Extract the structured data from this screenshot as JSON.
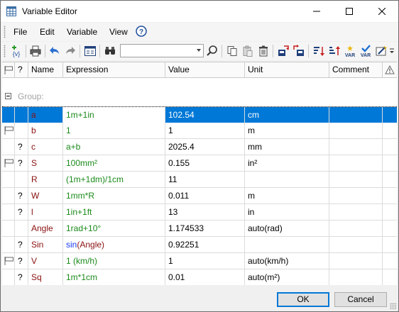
{
  "window": {
    "title": "Variable Editor"
  },
  "menu": [
    "File",
    "Edit",
    "Variable",
    "View"
  ],
  "toolbar": {
    "insert_label": "{v}",
    "search_value": ""
  },
  "columns": {
    "flag": "",
    "q": "?",
    "name": "Name",
    "expression": "Expression",
    "value": "Value",
    "unit": "Unit",
    "comment": "Comment"
  },
  "group": {
    "label": "Group:"
  },
  "rows": [
    {
      "flag": false,
      "q": "",
      "name": "a",
      "expression": "1m+1in",
      "value": "102.54",
      "unit": "cm"
    },
    {
      "flag": true,
      "q": "",
      "name": "b",
      "expression": "1",
      "value": "1",
      "unit": "m"
    },
    {
      "flag": false,
      "q": "?",
      "name": "c",
      "expression": "a+b",
      "value": "2025.4",
      "unit": "mm"
    },
    {
      "flag": true,
      "q": "?",
      "name": "S",
      "expression": "100mm²",
      "value": "0.155",
      "unit": "in²"
    },
    {
      "flag": false,
      "q": "",
      "name": "R",
      "expression": "(1m+1dm)/1cm",
      "value": "11",
      "unit": ""
    },
    {
      "flag": false,
      "q": "?",
      "name": "W",
      "expression": "1mm*R",
      "value": "0.011",
      "unit": "m"
    },
    {
      "flag": false,
      "q": "?",
      "name": "l",
      "expression": "1in+1ft",
      "value": "13",
      "unit": "in"
    },
    {
      "flag": false,
      "q": "",
      "name": "Angle",
      "expression": "1rad+10°",
      "value": "1.174533",
      "unit": "auto(rad)"
    },
    {
      "flag": false,
      "q": "?",
      "name": "Sin",
      "expression_fn": "sin",
      "expression_arg": "(Angle)",
      "value": "0.92251",
      "unit": ""
    },
    {
      "flag": true,
      "q": "?",
      "name": "V",
      "expression": "1 (km/h)",
      "value": "1",
      "unit": "auto(km/h)"
    },
    {
      "flag": false,
      "q": "?",
      "name": "Sq",
      "expression": "1m*1cm",
      "value": "0.01",
      "unit": "auto(m²)"
    }
  ],
  "buttons": {
    "ok": "OK",
    "cancel": "Cancel"
  },
  "colors": {
    "selection": "#0078d7",
    "name": "#8a1010",
    "expression": "#1a8a1a",
    "function": "#1a3cff"
  }
}
